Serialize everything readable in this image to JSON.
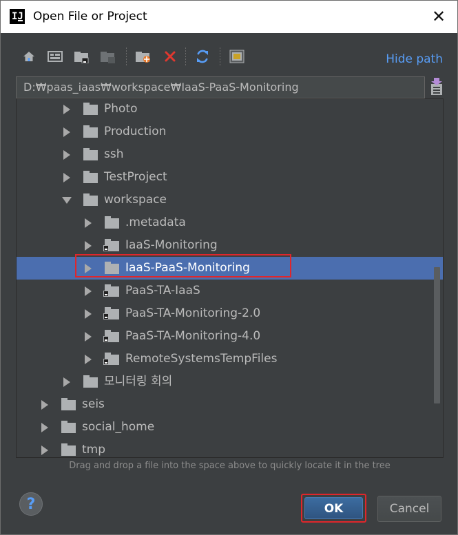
{
  "window": {
    "title": "Open File or Project",
    "close_glyph": "✕",
    "logo_text": "IJ"
  },
  "toolbar": {
    "icons": [
      "home-icon",
      "desktop-icon",
      "project-folder-icon",
      "module-folder-icon",
      "new-folder-icon",
      "delete-icon",
      "refresh-icon",
      "show-hidden-icon"
    ],
    "hide_path_label": "Hide path"
  },
  "path": {
    "value": "D:₩paas_iaas₩workspace₩IaaS-PaaS-Monitoring"
  },
  "tree": {
    "rows": [
      {
        "label": "Photo",
        "level": 2,
        "expanded": false,
        "module": false,
        "selected": false
      },
      {
        "label": "Production",
        "level": 2,
        "expanded": false,
        "module": false,
        "selected": false
      },
      {
        "label": "ssh",
        "level": 2,
        "expanded": false,
        "module": false,
        "selected": false
      },
      {
        "label": "TestProject",
        "level": 2,
        "expanded": false,
        "module": false,
        "selected": false
      },
      {
        "label": "workspace",
        "level": 2,
        "expanded": true,
        "module": false,
        "selected": false
      },
      {
        "label": ".metadata",
        "level": 3,
        "expanded": false,
        "module": false,
        "selected": false
      },
      {
        "label": "IaaS-Monitoring",
        "level": 3,
        "expanded": false,
        "module": true,
        "selected": false
      },
      {
        "label": "IaaS-PaaS-Monitoring",
        "level": 3,
        "expanded": false,
        "module": false,
        "selected": true
      },
      {
        "label": "PaaS-TA-IaaS",
        "level": 3,
        "expanded": false,
        "module": true,
        "selected": false
      },
      {
        "label": "PaaS-TA-Monitoring-2.0",
        "level": 3,
        "expanded": false,
        "module": true,
        "selected": false
      },
      {
        "label": "PaaS-TA-Monitoring-4.0",
        "level": 3,
        "expanded": false,
        "module": true,
        "selected": false
      },
      {
        "label": "RemoteSystemsTempFiles",
        "level": 3,
        "expanded": false,
        "module": true,
        "selected": false
      },
      {
        "label": "모니터링 회의",
        "level": 2,
        "expanded": false,
        "module": false,
        "selected": false
      },
      {
        "label": "seis",
        "level": 1,
        "expanded": false,
        "module": false,
        "selected": false
      },
      {
        "label": "social_home",
        "level": 1,
        "expanded": false,
        "module": false,
        "selected": false
      },
      {
        "label": "tmp",
        "level": 1,
        "expanded": false,
        "module": false,
        "selected": false
      }
    ]
  },
  "hint": "Drag and drop a file into the space above to quickly locate it in the tree",
  "buttons": {
    "help": "?",
    "ok": "OK",
    "cancel": "Cancel"
  },
  "colors": {
    "background": "#3c3f41",
    "selection": "#4b6eaf",
    "link": "#589df6",
    "highlight_outline": "#e0262b"
  }
}
